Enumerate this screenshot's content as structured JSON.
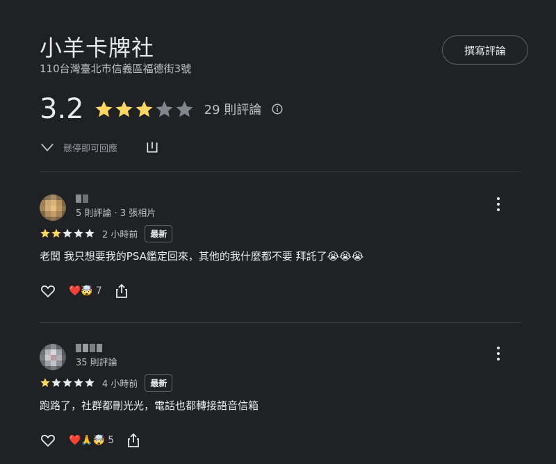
{
  "place": {
    "name": "小羊卡牌社",
    "address": "110台灣臺北市信義區福德街3號"
  },
  "header": {
    "write_review_label": "撰寫評論"
  },
  "summary": {
    "rating": "3.2",
    "rating_value": 3.2,
    "review_count": "29 則評論",
    "hint_text": "懸停即可回應"
  },
  "reviews": [
    {
      "meta": "5 則評論 · 3 張相片",
      "stars": 2,
      "time": "2 小時前",
      "badge": "最新",
      "text": "老闆 我只想要我的PSA鑑定回來，其他的我什麼都不要 拜託了😭😭😭",
      "reactions": "❤️🤯",
      "reaction_count": "7"
    },
    {
      "meta": "35 則評論",
      "stars": 1,
      "time": "4 小時前",
      "badge": "最新",
      "text": "跑路了，社群都刪光光，電話也都轉接語音信箱",
      "reactions": "❤️🙏🤯",
      "reaction_count": "5"
    }
  ],
  "colors": {
    "background": "#202124",
    "star_filled": "#fdd663",
    "star_empty": "#80868b",
    "text_primary": "#e8eaed",
    "text_secondary": "#bdc1c6",
    "divider": "#3c4043"
  },
  "icons": {
    "info": "info-icon",
    "chevron": "chevron-down-icon",
    "share": "share-icon",
    "heart": "heart-outline-icon",
    "more": "more-vert-icon"
  }
}
